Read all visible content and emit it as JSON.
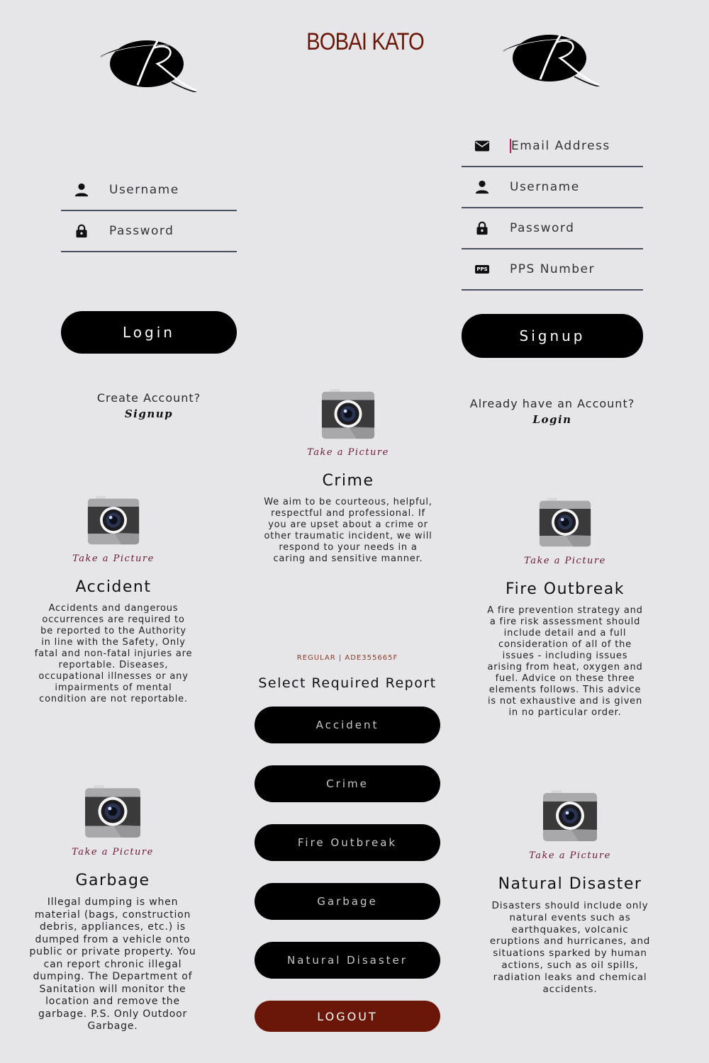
{
  "brand": {
    "title": "BOBAI KATO"
  },
  "login": {
    "username_placeholder": "Username",
    "password_placeholder": "Password",
    "login_label": "Login",
    "prompt": "Create Account?",
    "link": "Signup"
  },
  "signup": {
    "email_placeholder": "Email Address",
    "username_placeholder": "Username",
    "password_placeholder": "Password",
    "pps_placeholder": "PPS Number",
    "pps_icon_text": "PPS",
    "signup_label": "Signup",
    "prompt": "Already have an Account?",
    "link": "Login"
  },
  "take_picture_label": "Take a Picture",
  "cards": {
    "crime": {
      "title": "Crime",
      "text": "We aim to be courteous, helpful, respectful and professional. If you are upset about a crime or other traumatic incident, we will respond to your needs in a caring and sensitive manner."
    },
    "accident": {
      "title": "Accident",
      "text": "Accidents and dangerous occurrences are required to be reported to the Authority in line with the Safety, Only fatal and non-fatal injuries are reportable. Diseases, occupational illnesses or any impairments of mental condition are not reportable."
    },
    "fire": {
      "title": "Fire Outbreak",
      "text": "A fire prevention strategy and a fire risk assessment should include detail and a full consideration of all of the issues - including issues arising from heat, oxygen and fuel. Advice on these three elements follows. This advice is not exhaustive and is given in no particular order."
    },
    "garbage": {
      "title": "Garbage",
      "text": "Illegal dumping is when material (bags, construction debris, appliances, etc.) is dumped from a vehicle onto public or private property. You can report chronic illegal dumping. The Department of Sanitation will monitor the location and remove the garbage. P.S. Only Outdoor Garbage."
    },
    "natural": {
      "title": "Natural Disaster",
      "text": "Disasters should include only natural events such as earthquakes, volcanic eruptions and hurricanes, and situations sparked by human actions, such as oil spills, radiation leaks and chemical accidents."
    }
  },
  "report_menu": {
    "meta": "REGULAR | ADE355665F",
    "title": "Select Required Report",
    "buttons": [
      "Accident",
      "Crime",
      "Fire Outbreak",
      "Garbage",
      "Natural Disaster"
    ],
    "logout": "LOGOUT"
  },
  "colors": {
    "background": "#e6e6e8",
    "brand": "#6a1708",
    "take_picture": "#6b1730",
    "logout": "#6a1608",
    "button": "#000000",
    "focus_caret": "#c2185b"
  },
  "icons": {
    "logo": "r-logo",
    "user": "user-icon",
    "lock": "lock-icon",
    "email": "envelope-icon",
    "pps": "pps-card-icon",
    "camera": "camera-icon"
  }
}
